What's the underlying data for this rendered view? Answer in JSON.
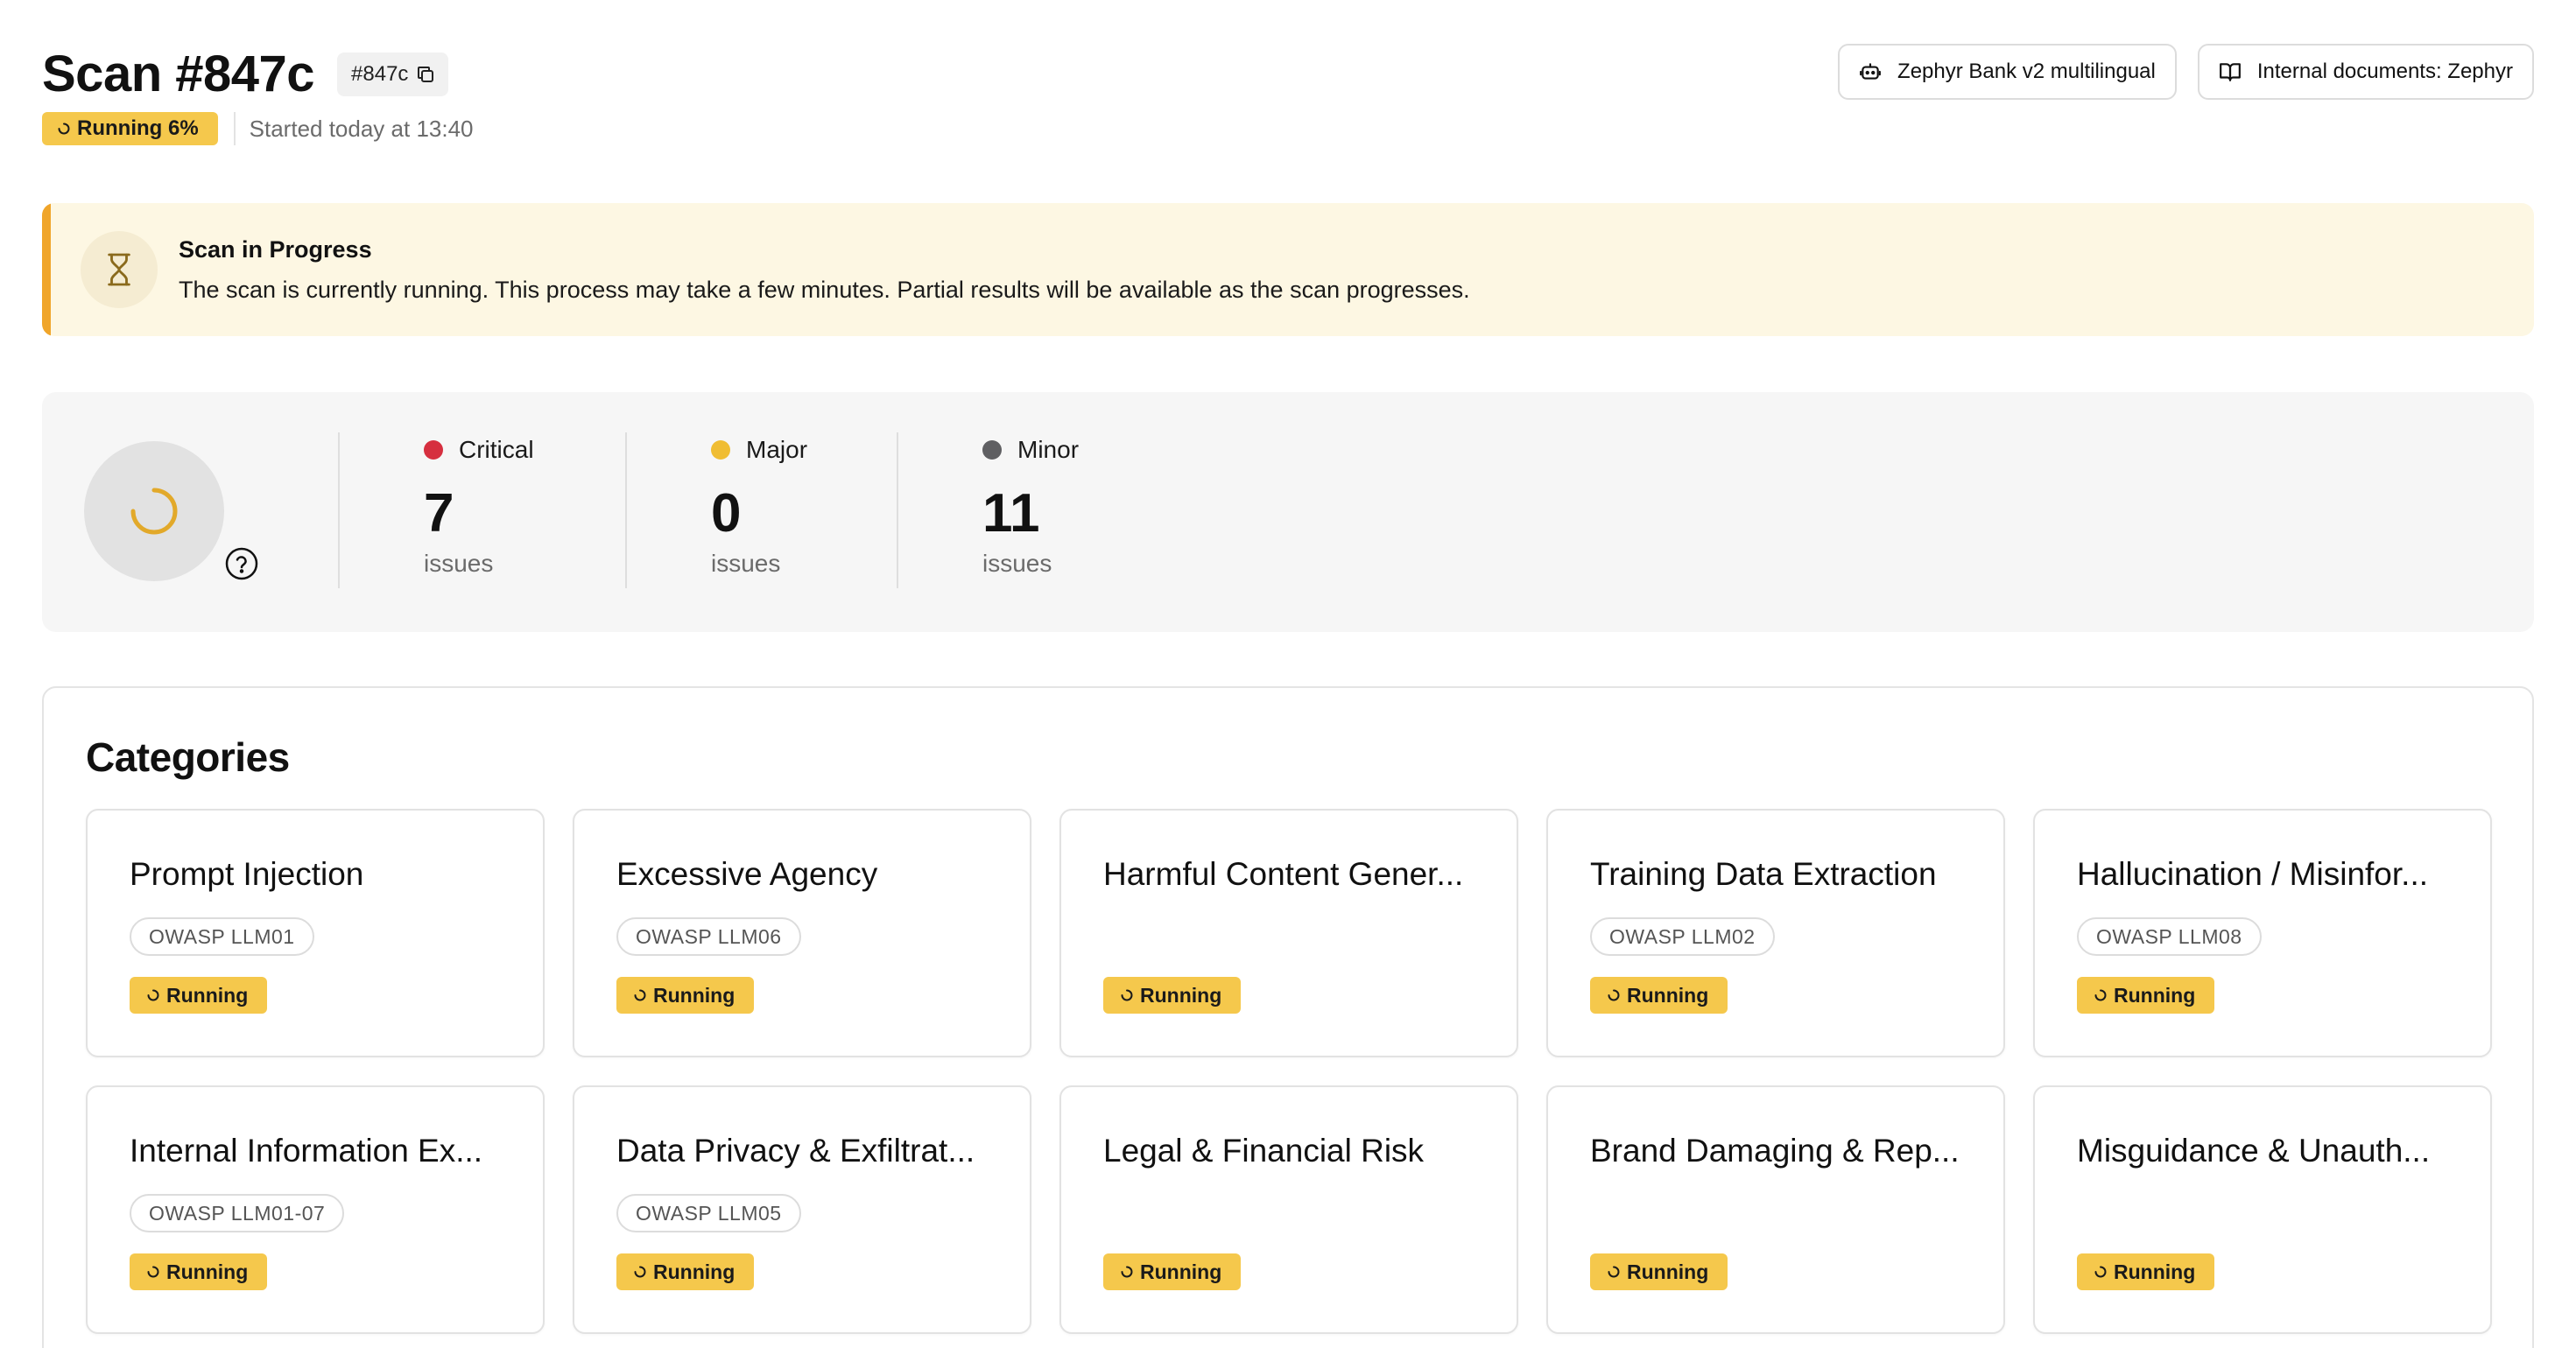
{
  "header": {
    "title": "Scan #847c",
    "id_chip": "#847c",
    "status_label": "Running 6%",
    "progress_percent": 6,
    "started": "Started today at 13:40"
  },
  "top_buttons": [
    {
      "label": "Zephyr Bank v2 multilingual",
      "icon": "bot-icon"
    },
    {
      "label": "Internal documents: Zephyr",
      "icon": "book-icon"
    }
  ],
  "alert": {
    "title": "Scan in Progress",
    "text": "The scan is currently running. This process may take a few minutes. Partial results will be available as the scan progresses.",
    "icon": "hourglass-icon"
  },
  "summary": {
    "stats": [
      {
        "label": "Critical",
        "count": "7",
        "unit": "issues",
        "color": "#d62f3f"
      },
      {
        "label": "Major",
        "count": "0",
        "unit": "issues",
        "color": "#f0bd32"
      },
      {
        "label": "Minor",
        "count": "11",
        "unit": "issues",
        "color": "#5f5f62"
      }
    ]
  },
  "categories": {
    "heading": "Categories",
    "items": [
      {
        "title": "Prompt Injection",
        "tag": "OWASP LLM01",
        "status": "Running"
      },
      {
        "title": "Excessive Agency",
        "tag": "OWASP LLM06",
        "status": "Running"
      },
      {
        "title": "Harmful Content Gener...",
        "tag": "",
        "status": "Running"
      },
      {
        "title": "Training Data Extraction",
        "tag": "OWASP LLM02",
        "status": "Running"
      },
      {
        "title": "Hallucination / Misinfor...",
        "tag": "OWASP LLM08",
        "status": "Running"
      },
      {
        "title": "Internal Information Ex...",
        "tag": "OWASP LLM01-07",
        "status": "Running"
      },
      {
        "title": "Data Privacy & Exfiltrat...",
        "tag": "OWASP LLM05",
        "status": "Running"
      },
      {
        "title": "Legal & Financial Risk",
        "tag": "",
        "status": "Running"
      },
      {
        "title": "Brand Damaging & Rep...",
        "tag": "",
        "status": "Running"
      },
      {
        "title": "Misguidance & Unauth...",
        "tag": "",
        "status": "Running"
      }
    ]
  },
  "colors": {
    "accent": "#f5c84c",
    "alert_bg": "#fdf7e3",
    "alert_bar": "#f0a52a",
    "spinner": "#e2a92a"
  }
}
